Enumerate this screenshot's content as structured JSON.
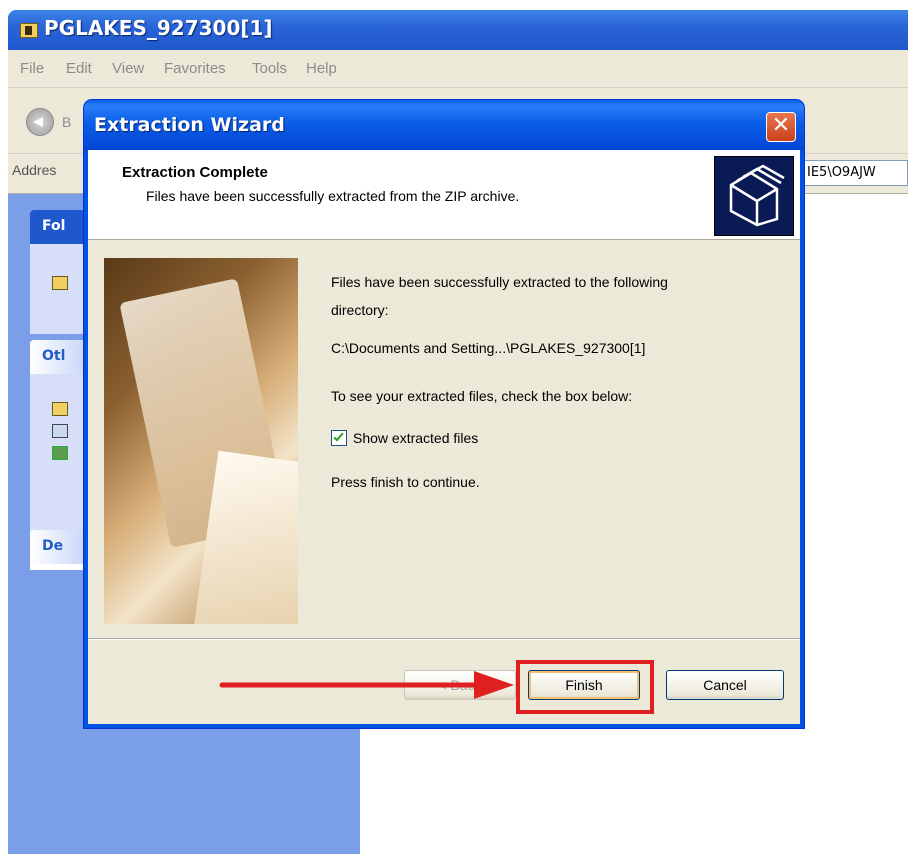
{
  "explorer": {
    "title": "PGLAKES_927300[1]",
    "menu": [
      "File",
      "Edit",
      "View",
      "Favorites",
      "Tools",
      "Help"
    ],
    "back_label": "B",
    "address_label": "Addres",
    "address_value": "IE5\\O9AJW",
    "sidebar_panels": [
      "Fol",
      "Otl",
      "De"
    ]
  },
  "dialog": {
    "title": "Extraction Wizard",
    "close_glyph": "✕",
    "header": {
      "title": "Extraction Complete",
      "subtitle": "Files have been successfully extracted from the ZIP archive."
    },
    "body": {
      "intro_line1": "Files have been successfully extracted to the following",
      "intro_line2": "directory:",
      "path": "C:\\Documents and Setting...\\PGLAKES_927300[1]",
      "check_prompt": "To see your extracted files, check the box below:",
      "checkbox_label": "Show extracted files",
      "checkbox_checked": true,
      "finish_prompt": "Press finish to continue."
    },
    "buttons": {
      "back": "< Back",
      "finish": "Finish",
      "cancel": "Cancel"
    }
  },
  "colors": {
    "titlebar_blue": "#0a5ee8",
    "annotation_red": "#e02020"
  }
}
